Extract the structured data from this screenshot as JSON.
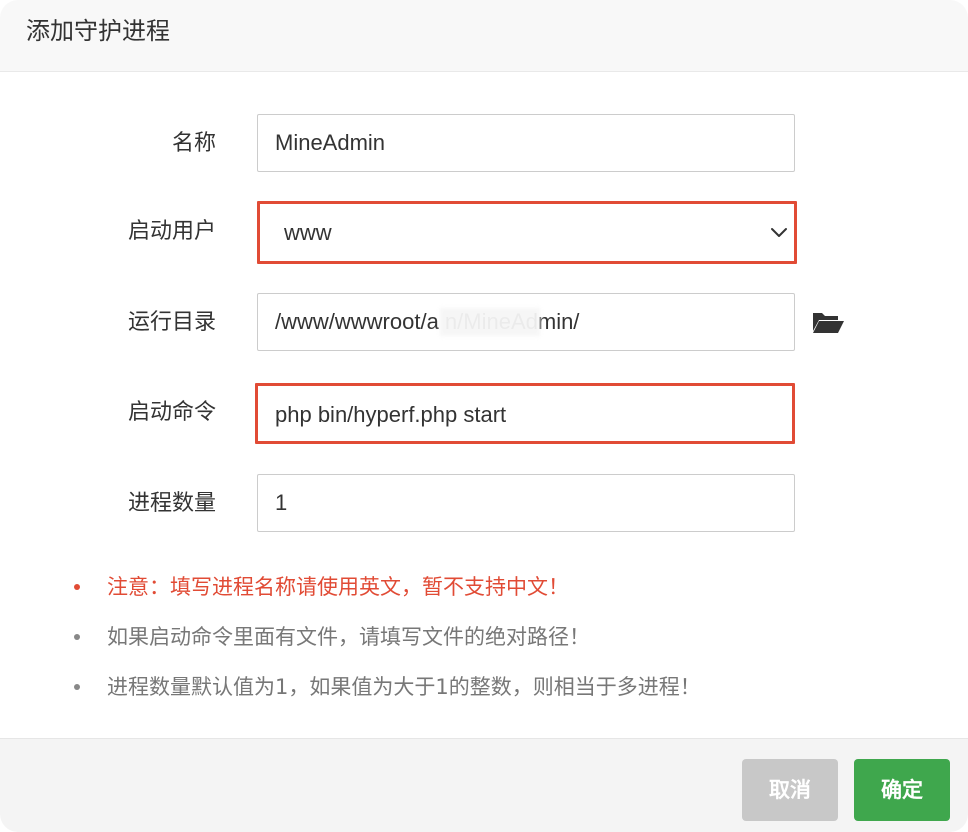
{
  "dialog": {
    "title": "添加守护进程"
  },
  "form": {
    "name": {
      "label": "名称",
      "value": "MineAdmin"
    },
    "user": {
      "label": "启动用户",
      "value": "www"
    },
    "dir": {
      "label": "运行目录",
      "value": "/www/wwwroot/a            n/MineAdmin/"
    },
    "command": {
      "label": "启动命令",
      "value": "php bin/hyperf.php start"
    },
    "count": {
      "label": "进程数量",
      "value": "1"
    }
  },
  "notes": [
    "注意：填写进程名称请使用英文，暂不支持中文！",
    "如果启动命令里面有文件，请填写文件的绝对路径！",
    "进程数量默认值为1，如果值为大于1的整数，则相当于多进程！"
  ],
  "footer": {
    "cancel_label": "取消",
    "ok_label": "确定"
  },
  "colors": {
    "highlight": "#e14b35",
    "ok_button": "#3fa74d",
    "cancel_button": "#c8c8c8",
    "warning_text": "#e14b35"
  },
  "icons": {
    "select": "chevron-down-icon",
    "directory": "folder-open-icon"
  }
}
